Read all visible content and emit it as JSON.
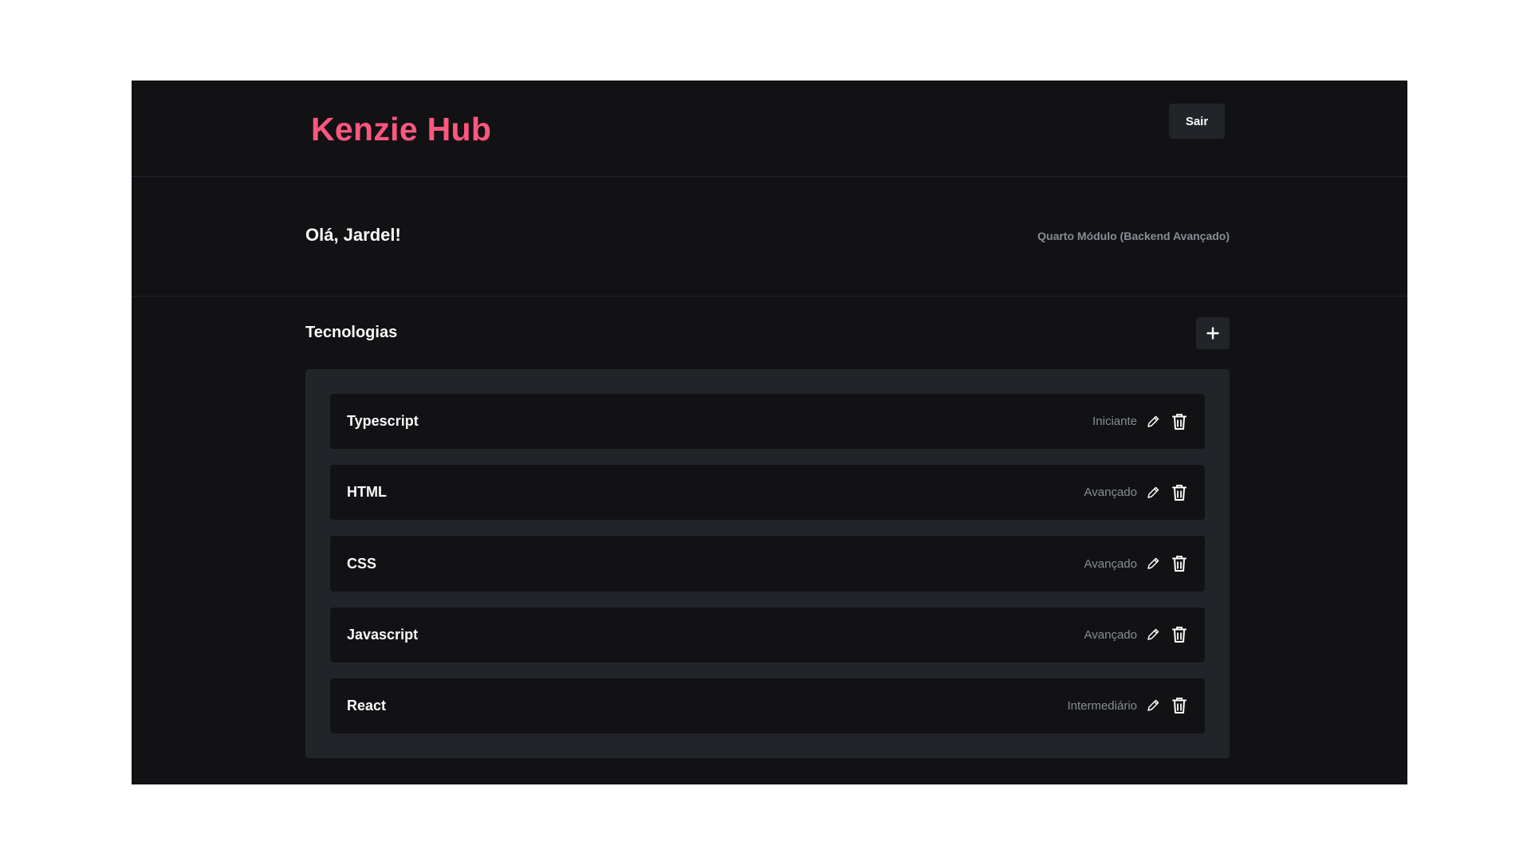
{
  "header": {
    "logo": "Kenzie Hub",
    "logout_label": "Sair"
  },
  "greeting": {
    "title": "Olá, Jardel!",
    "module": "Quarto Módulo (Backend Avançado)"
  },
  "technologies": {
    "title": "Tecnologias",
    "add_icon": "plus-icon",
    "items": [
      {
        "name": "Typescript",
        "status": "Iniciante"
      },
      {
        "name": "HTML",
        "status": "Avançado"
      },
      {
        "name": "CSS",
        "status": "Avançado"
      },
      {
        "name": "Javascript",
        "status": "Avançado"
      },
      {
        "name": "React",
        "status": "Intermediário"
      }
    ]
  },
  "colors": {
    "brand": "#ff577f",
    "background": "#121214",
    "surface": "#212529",
    "muted_text": "#868e96"
  }
}
